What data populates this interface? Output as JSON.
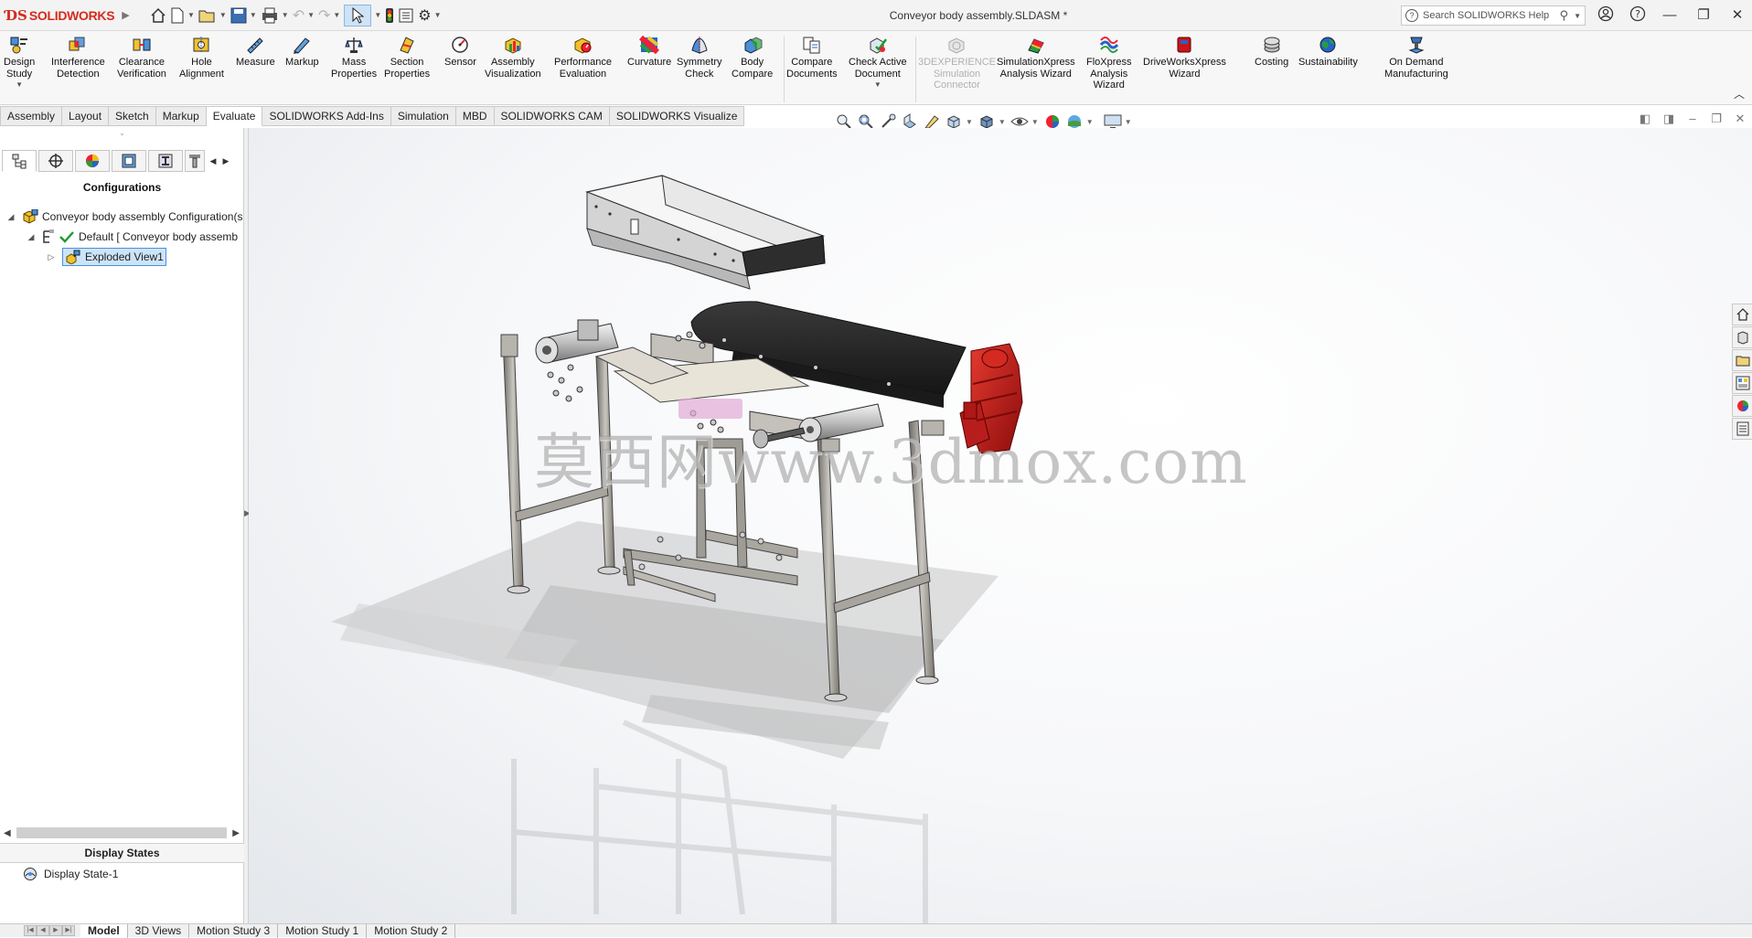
{
  "app": {
    "name": "SOLIDWORKS",
    "document_title": "Conveyor body assembly.SLDASM *",
    "help_search_placeholder": "Search SOLIDWORKS Help"
  },
  "commands": [
    {
      "label": "Design\nStudy",
      "icon": "design-study-icon",
      "dropdown": true
    },
    {
      "label": "Interference\nDetection",
      "icon": "interference-icon"
    },
    {
      "label": "Clearance\nVerification",
      "icon": "clearance-icon"
    },
    {
      "label": "Hole\nAlignment",
      "icon": "hole-alignment-icon"
    },
    {
      "label": "Measure",
      "icon": "measure-icon"
    },
    {
      "label": "Markup",
      "icon": "markup-icon"
    },
    {
      "label": "Mass\nProperties",
      "icon": "mass-properties-icon"
    },
    {
      "label": "Section\nProperties",
      "icon": "section-properties-icon"
    },
    {
      "label": "Sensor",
      "icon": "sensor-icon"
    },
    {
      "label": "Assembly\nVisualization",
      "icon": "assembly-visualization-icon"
    },
    {
      "label": "Performance\nEvaluation",
      "icon": "performance-icon"
    },
    {
      "label": "Curvature",
      "icon": "curvature-icon"
    },
    {
      "label": "Symmetry\nCheck",
      "icon": "symmetry-icon"
    },
    {
      "label": "Body\nCompare",
      "icon": "body-compare-icon"
    },
    {
      "label": "Compare\nDocuments",
      "icon": "compare-documents-icon"
    },
    {
      "label": "Check Active\nDocument",
      "icon": "check-document-icon",
      "dropdown": true
    },
    {
      "label": "3DEXPERIENCE\nSimulation\nConnector",
      "icon": "3dexperience-icon",
      "disabled": true
    },
    {
      "label": "SimulationXpress\nAnalysis Wizard",
      "icon": "simulationxpress-icon"
    },
    {
      "label": "FloXpress\nAnalysis\nWizard",
      "icon": "floxpress-icon"
    },
    {
      "label": "DriveWorksXpress\nWizard",
      "icon": "driveworks-icon"
    },
    {
      "label": "Costing",
      "icon": "costing-icon"
    },
    {
      "label": "Sustainability",
      "icon": "sustainability-icon"
    },
    {
      "label": "On Demand\nManufacturing",
      "icon": "manufacturing-icon"
    }
  ],
  "tabs": [
    "Assembly",
    "Layout",
    "Sketch",
    "Markup",
    "Evaluate",
    "SOLIDWORKS Add-Ins",
    "Simulation",
    "MBD",
    "SOLIDWORKS CAM",
    "SOLIDWORKS Visualize"
  ],
  "active_tab": "Evaluate",
  "left_panel": {
    "title": "Configurations",
    "tree": [
      {
        "label": "Conveyor body assembly Configuration(s",
        "level": 0,
        "expander": "down"
      },
      {
        "label": "Default [ Conveyor body assemb",
        "level": 1,
        "expander": "down"
      },
      {
        "label": "Exploded View1",
        "level": 2,
        "expander": "right",
        "selected": true
      }
    ],
    "display_states_title": "Display States",
    "display_state": "Display State-1"
  },
  "graphics": {
    "watermark": "莫西网www.3dmox.com"
  },
  "bottom_tabs": [
    "Model",
    "3D Views",
    "Motion Study 3",
    "Motion Study 1",
    "Motion Study 2"
  ],
  "active_bottom_tab": "Model",
  "colors": {
    "brand_red": "#d52b1e",
    "selection": "#cce4f7",
    "motor_red": "#c8161b",
    "belt_black": "#2a2a2a",
    "frame_steel": "#9a9690"
  }
}
